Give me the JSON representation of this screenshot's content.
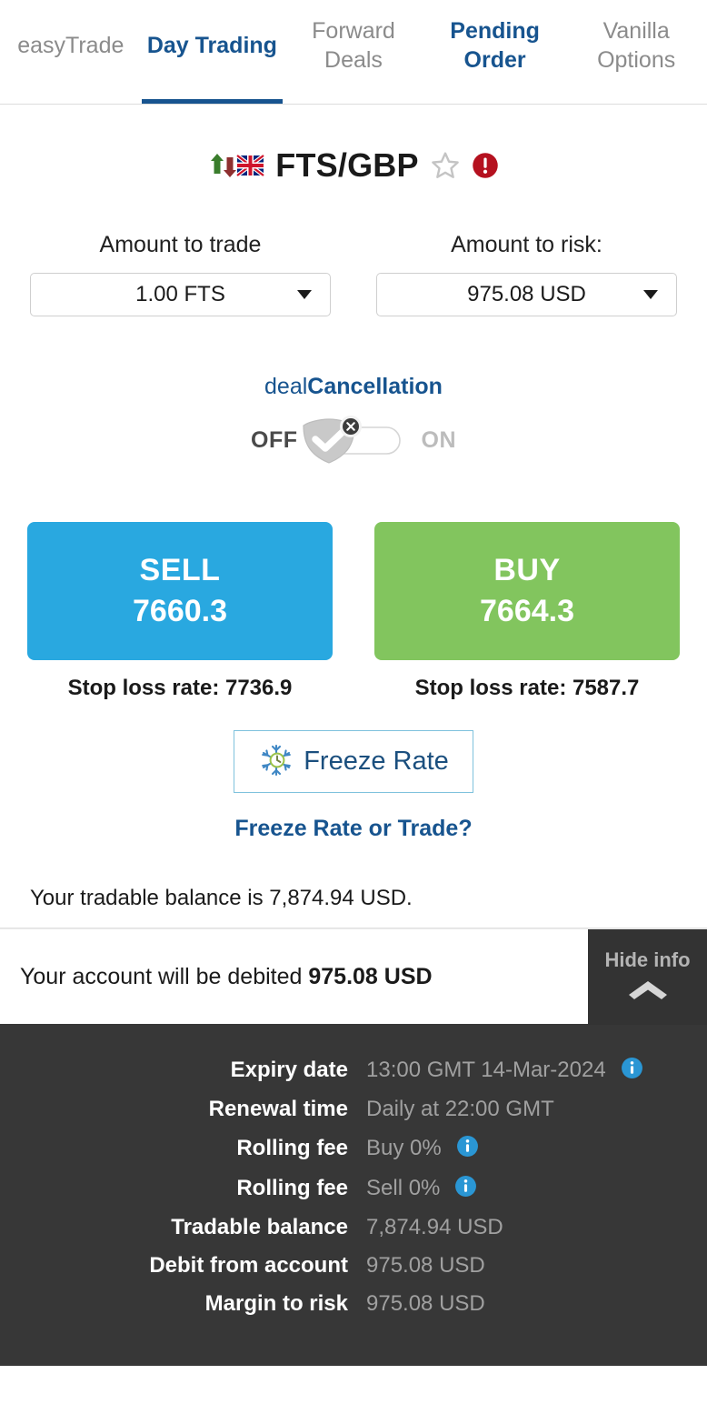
{
  "tabs": [
    {
      "label": "easyTrade",
      "state": "inactive"
    },
    {
      "label": "Day Trading",
      "state": "active"
    },
    {
      "label": "Forward Deals",
      "state": "inactive"
    },
    {
      "label": "Pending Order",
      "state": "link"
    },
    {
      "label": "Vanilla Options",
      "state": "inactive"
    }
  ],
  "instrument": {
    "pair": "FTS/GBP",
    "favorite_icon": "star-outline-icon",
    "alert_icon": "alert-circle-icon",
    "flag_icon": "uk-flag-icon",
    "direction_icon": "up-down-arrows-icon"
  },
  "trade_form": {
    "amount_label": "Amount to trade",
    "amount_value": "1.00 FTS",
    "risk_label": "Amount to risk:",
    "risk_value": "975.08 USD"
  },
  "deal_cancellation": {
    "title_light": "deal",
    "title_bold": "Cancellation",
    "off_label": "OFF",
    "on_label": "ON",
    "state": "OFF"
  },
  "trade": {
    "sell_label": "SELL",
    "sell_rate": "7660.3",
    "sell_stoploss": "Stop loss rate: 7736.9",
    "buy_label": "BUY",
    "buy_rate": "7664.3",
    "buy_stoploss": "Stop loss rate: 7587.7",
    "sell_color": "#29a8e0",
    "buy_color": "#82c55e"
  },
  "freeze": {
    "button_label": "Freeze Rate",
    "link_label": "Freeze Rate or Trade?",
    "icon": "snowflake-clock-icon"
  },
  "balance_note": "Your tradable balance is 7,874.94 USD.",
  "debited": {
    "prefix": "Your account will be debited ",
    "amount": "975.08 USD",
    "hide_info_label": "Hide info",
    "hide_info_icon": "chevron-up-icon"
  },
  "info_panel": {
    "rows": [
      {
        "label": "Expiry date",
        "value": "13:00 GMT 14-Mar-2024",
        "info": true
      },
      {
        "label": "Renewal time",
        "value": "Daily at 22:00 GMT",
        "info": false
      },
      {
        "label": "Rolling fee",
        "value": "Buy 0%",
        "info": true
      },
      {
        "label": "Rolling fee",
        "value": "Sell 0%",
        "info": true
      },
      {
        "label": "Tradable balance",
        "value": "7,874.94 USD",
        "info": false
      },
      {
        "label": "Debit from account",
        "value": "975.08 USD",
        "info": false
      },
      {
        "label": "Margin to risk",
        "value": "975.08 USD",
        "info": false
      }
    ],
    "background": "#373737",
    "info_icon_color": "#2a96d4"
  }
}
